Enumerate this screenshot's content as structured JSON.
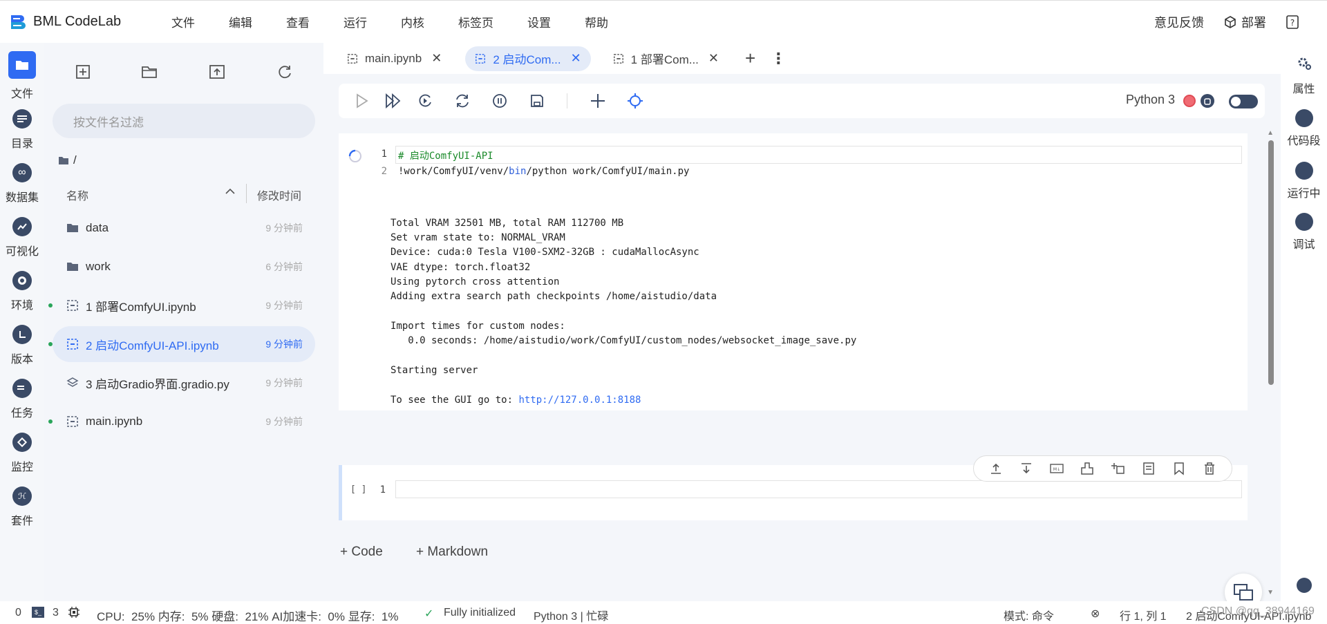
{
  "app": {
    "title": "BML CodeLab"
  },
  "menu": [
    "文件",
    "编辑",
    "查看",
    "运行",
    "内核",
    "标签页",
    "设置",
    "帮助"
  ],
  "topright": {
    "feedback": "意见反馈",
    "deploy": "部署"
  },
  "leftrail": [
    "文件",
    "目录",
    "数据集",
    "可视化",
    "环境",
    "版本",
    "任务",
    "监控",
    "套件"
  ],
  "filepanel": {
    "filter_placeholder": "按文件名过滤",
    "path": "/",
    "col_name": "名称",
    "col_time": "修改时间",
    "files": [
      {
        "name": "data",
        "time": "9 分钟前",
        "kind": "folder"
      },
      {
        "name": "work",
        "time": "6 分钟前",
        "kind": "folder"
      },
      {
        "name": "1 部署ComfyUI.ipynb",
        "time": "9 分钟前",
        "kind": "notebook"
      },
      {
        "name": "2 启动ComfyUI-API.ipynb",
        "time": "9 分钟前",
        "kind": "notebook"
      },
      {
        "name": "3 启动Gradio界面.gradio.py",
        "time": "9 分钟前",
        "kind": "gradio"
      },
      {
        "name": "main.ipynb",
        "time": "9 分钟前",
        "kind": "notebook"
      }
    ]
  },
  "tabs": [
    {
      "label": "main.ipynb",
      "active": false
    },
    {
      "label": "2 启动Com...",
      "active": true
    },
    {
      "label": "1 部署Com...",
      "active": false
    }
  ],
  "toolbar": {
    "kernel": "Python 3"
  },
  "cell1": {
    "line1": "# 启动ComfyUI-API",
    "line2_a": "!work/ComfyUI/venv/",
    "line2_b": "bin",
    "line2_c": "/python work/ComfyUI/main.py"
  },
  "output": {
    "lines": [
      "Total VRAM 32501 MB, total RAM 112700 MB",
      "Set vram state to: NORMAL_VRAM",
      "Device: cuda:0 Tesla V100-SXM2-32GB : cudaMallocAsync",
      "VAE dtype: torch.float32",
      "Using pytorch cross attention",
      "Adding extra search path checkpoints /home/aistudio/data",
      "",
      "Import times for custom nodes:",
      "   0.0 seconds: /home/aistudio/work/ComfyUI/custom_nodes/websocket_image_save.py",
      "",
      "Starting server",
      ""
    ],
    "gui_prefix": "To see the GUI go to: ",
    "gui_link": "http://127.0.0.1:8188"
  },
  "cell2": {
    "prompt": "[ ]",
    "line": "1"
  },
  "add": {
    "code": "+ Code",
    "markdown": "+ Markdown"
  },
  "rightrail": [
    "属性",
    "代码段",
    "运行中",
    "调试"
  ],
  "status": {
    "zero": "0",
    "terminals": "3",
    "resources": "CPU:  25% 内存:  5% 硬盘:  21% AI加速卡:  0% 显存:  1%",
    "init": "Fully initialized",
    "kernel": "Python 3 | 忙碌",
    "mode": "模式: 命令",
    "position": "行 1, 列 1",
    "file": "2 启动ComfyUI-API.ipynb",
    "watermark": "CSDN @qq_38944169"
  },
  "colors": {
    "accent": "#2f6bf2",
    "rail_icon": "#3a4a66",
    "busy_dot": "#f06b73"
  }
}
